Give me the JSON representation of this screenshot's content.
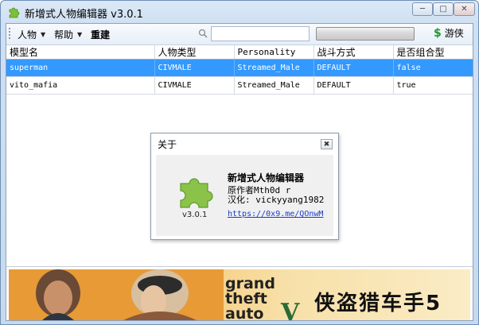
{
  "window": {
    "title": "新增式人物编辑器 v3.0.1",
    "minimize_icon": "minimize-icon",
    "maximize_icon": "maximize-icon",
    "close_icon": "close-icon"
  },
  "toolbar": {
    "menu_person": "人物",
    "menu_help": "帮助",
    "menu_new": "重建",
    "search_placeholder": "",
    "progress_fraction": 0.0,
    "play_label": "游侠",
    "play_icon": "dollar-icon"
  },
  "table": {
    "headers": [
      "模型名",
      "人物类型",
      "Personality",
      "战斗方式",
      "是否组合型"
    ],
    "rows": [
      [
        "superman",
        "CIVMALE",
        "Streamed_Male",
        "DEFAULT",
        "false"
      ],
      [
        "vito_mafia",
        "CIVMALE",
        "Streamed_Male",
        "DEFAULT",
        "true"
      ]
    ],
    "selected_row": 0
  },
  "dialog": {
    "title": "关于",
    "app_name": "新增式人物编辑器",
    "author": "原作者Mth0d r",
    "localization": "汉化: vickyyang1982",
    "link": "https://0x9.me/QOnwM",
    "version": "v3.0.1",
    "icon": "puzzle-piece-icon"
  },
  "banner": {
    "text": "侠盗猎车手5",
    "logo_lines": [
      "grand",
      "theft",
      "auto"
    ],
    "logo_numeral": "V"
  },
  "colors": {
    "selection": "#3399ff",
    "link": "#1a3cc8",
    "puzzle": "#8bc34a",
    "banner_orange": "#f2a43a"
  }
}
